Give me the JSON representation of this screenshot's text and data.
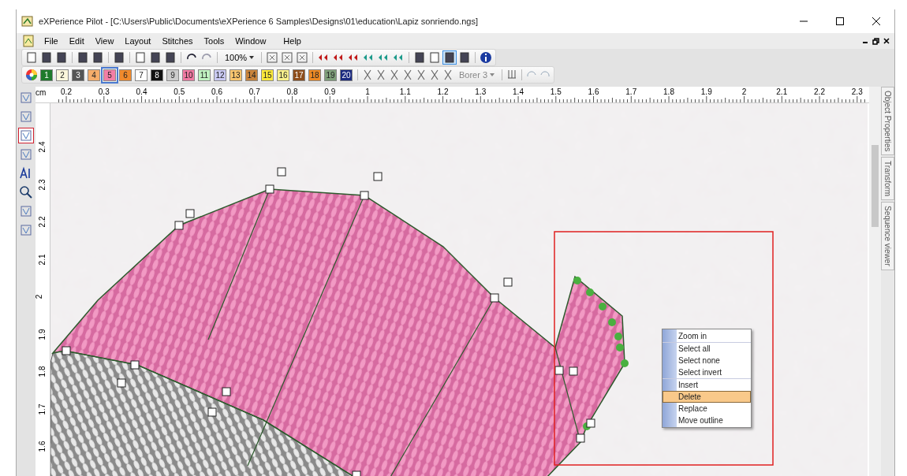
{
  "window": {
    "title": "eXPerience Pilot - [C:\\Users\\Public\\Documents\\eXPerience 6 Samples\\Designs\\01\\education\\Lapiz sonriendo.ngs]"
  },
  "menu": [
    "File",
    "Edit",
    "View",
    "Layout",
    "Stitches",
    "Tools",
    "Window",
    "Help"
  ],
  "toolbar": {
    "zoom": "100%"
  },
  "swatches": [
    {
      "label": "1",
      "color": "#1f7a2c",
      "selected": false
    },
    {
      "label": "2",
      "color": "#fbf7dc",
      "selected": false
    },
    {
      "label": "3",
      "color": "#555555",
      "selected": false
    },
    {
      "label": "4",
      "color": "#f6ad6a",
      "selected": false
    },
    {
      "label": "5",
      "color": "#f37ea6",
      "selected": true
    },
    {
      "label": "6",
      "color": "#f08a2c",
      "selected": false
    },
    {
      "label": "7",
      "color": "#ffffff",
      "selected": false
    },
    {
      "label": "8",
      "color": "#111111",
      "selected": false
    },
    {
      "label": "9",
      "color": "#cccccc",
      "selected": false
    },
    {
      "label": "10",
      "color": "#f07aa2",
      "selected": false
    },
    {
      "label": "11",
      "color": "#bff2c0",
      "selected": false
    },
    {
      "label": "12",
      "color": "#c9c9f2",
      "selected": false
    },
    {
      "label": "13",
      "color": "#f9c56e",
      "selected": false
    },
    {
      "label": "14",
      "color": "#c9843c",
      "selected": false
    },
    {
      "label": "15",
      "color": "#fbe83a",
      "selected": false
    },
    {
      "label": "16",
      "color": "#f9f08c",
      "selected": false
    },
    {
      "label": "17",
      "color": "#8e4e1c",
      "selected": false
    },
    {
      "label": "18",
      "color": "#ee8a24",
      "selected": false
    },
    {
      "label": "19",
      "color": "#7fa07a",
      "selected": false
    },
    {
      "label": "20",
      "color": "#1b2a80",
      "selected": false
    }
  ],
  "stitch_tool": {
    "borer": "Borer 3"
  },
  "tools": [
    {
      "selected": false
    },
    {
      "selected": false
    },
    {
      "selected": true
    },
    {
      "selected": false
    },
    {
      "selected": false
    },
    {
      "selected": false
    },
    {
      "selected": false
    },
    {
      "selected": false
    }
  ],
  "horizontal_ruler": {
    "unit": "cm",
    "labels": [
      "0.2",
      "0.3",
      "0.4",
      "0.5",
      "0.6",
      "0.7",
      "0.8",
      "0.9",
      "1",
      "1.1",
      "1.2",
      "1.3",
      "1.4",
      "1.5",
      "1.6",
      "1.7",
      "1.8",
      "1.9",
      "2",
      "2.1",
      "2.2",
      "2.3"
    ]
  },
  "vertical_ruler": {
    "labels": [
      "2.4",
      "2.3",
      "2.2",
      "2.1",
      "2",
      "1.9",
      "1.8",
      "1.7",
      "1.6"
    ]
  },
  "side_tabs": [
    "Object Properties",
    "Transform",
    "Sequence viewer"
  ],
  "context_menu": [
    {
      "label": "Zoom in",
      "separator_before": false,
      "selected": false
    },
    {
      "label": "Select all",
      "separator_before": true,
      "selected": false
    },
    {
      "label": "Select none",
      "separator_before": false,
      "selected": false
    },
    {
      "label": "Select invert",
      "separator_before": false,
      "selected": false
    },
    {
      "label": "Insert",
      "separator_before": true,
      "selected": false
    },
    {
      "label": "Delete",
      "separator_before": false,
      "selected": true
    },
    {
      "label": "Replace",
      "separator_before": false,
      "selected": false
    },
    {
      "label": "Move outline",
      "separator_before": false,
      "selected": false
    }
  ]
}
